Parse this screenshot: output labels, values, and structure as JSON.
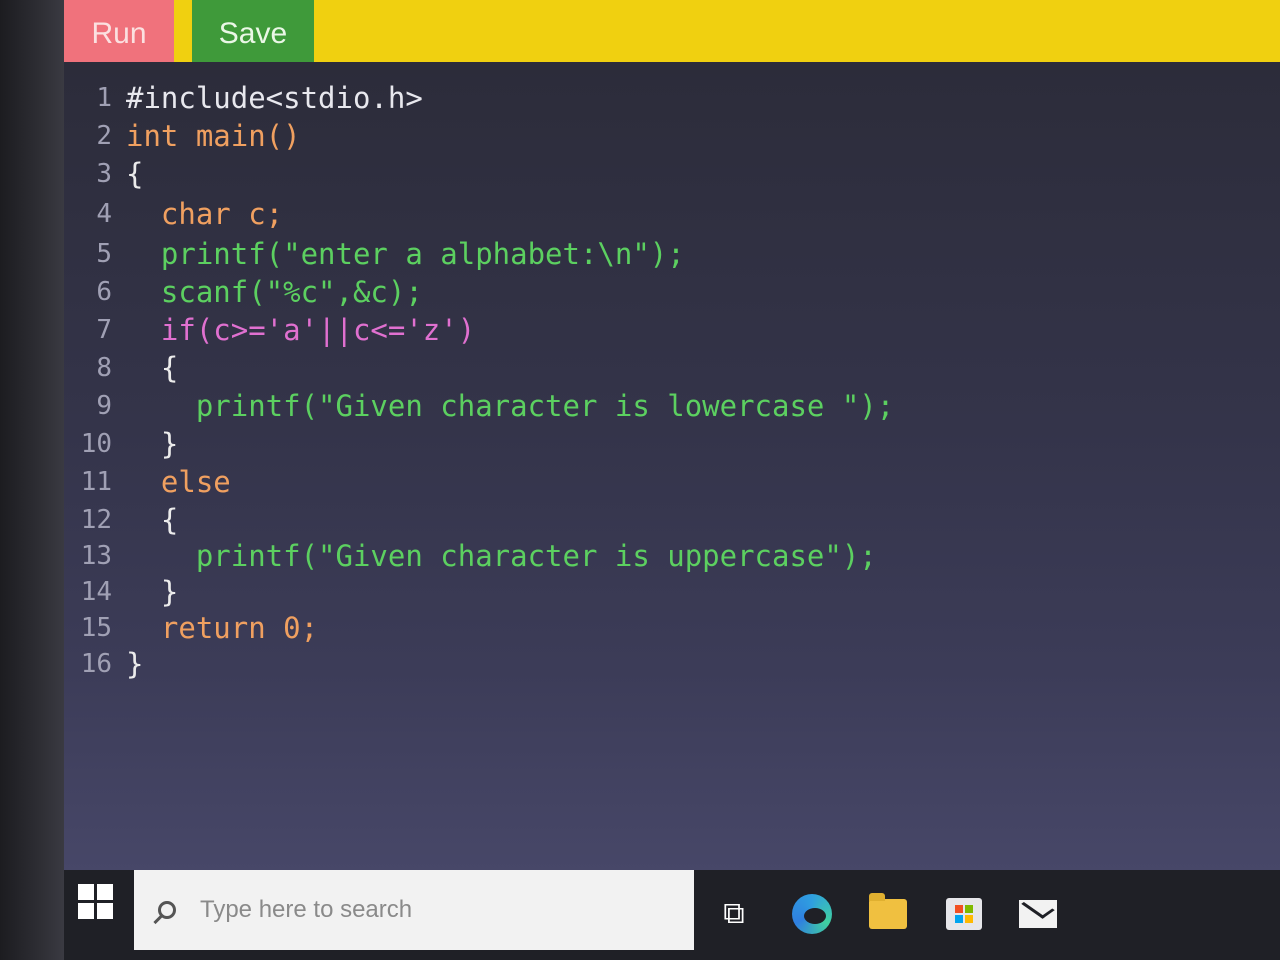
{
  "toolbar": {
    "run_label": "Run",
    "save_label": "Save"
  },
  "editor": {
    "lines": [
      {
        "number": "1",
        "text": "#include<stdio.h>"
      },
      {
        "number": "2",
        "text": "int main()"
      },
      {
        "number": "3",
        "text": "{"
      },
      {
        "number": "4",
        "text": "  char c;"
      },
      {
        "number": "5",
        "text": "  printf(\"enter a alphabet:\\n\");"
      },
      {
        "number": "6",
        "text": "  scanf(\"%c\",&c);"
      },
      {
        "number": "7",
        "text": "  if(c>='a'||c<='z')"
      },
      {
        "number": "8",
        "text": "  {"
      },
      {
        "number": "9",
        "text": "    printf(\"Given character is lowercase \");"
      },
      {
        "number": "10",
        "text": "  }"
      },
      {
        "number": "11",
        "text": "  else"
      },
      {
        "number": "12",
        "text": "  {"
      },
      {
        "number": "13",
        "text": "    printf(\"Given character is uppercase\");"
      },
      {
        "number": "14",
        "text": "  }"
      },
      {
        "number": "15",
        "text": "  return 0;"
      },
      {
        "number": "16",
        "text": "}"
      }
    ]
  },
  "taskbar": {
    "search_placeholder": "Type here to search",
    "icons": [
      "windows-start-icon",
      "search-icon",
      "task-view-icon",
      "edge-browser-icon",
      "file-explorer-icon",
      "store-icon",
      "mail-icon"
    ]
  },
  "colors": {
    "toolbar_bg": "#f0d010",
    "run_button": "#f0727c",
    "save_button": "#3f9a3a",
    "editor_bg": "#2c2c3a",
    "keyword": "#f0a060",
    "function": "#5cd060",
    "string": "#f0f0b0"
  }
}
